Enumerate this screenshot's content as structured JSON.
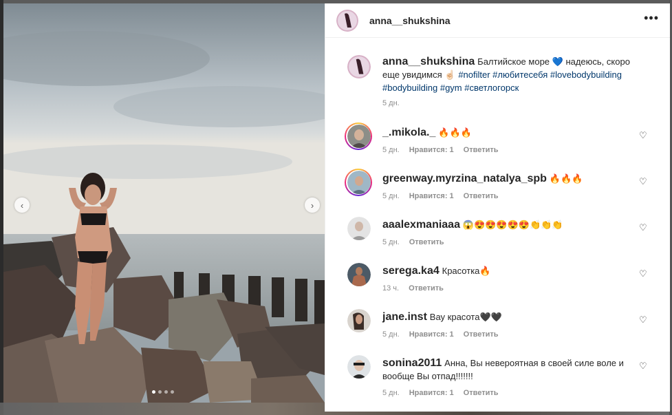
{
  "post": {
    "username": "anna__shukshina",
    "caption": {
      "text": "Балтийское море 💙 надеюсь, скоро еще увидимся ☝🏻",
      "hashtags": "#nofilter #любитесебя #lovebodybuilding #bodybuilding #gym #светлогорск",
      "time": "5 дн."
    },
    "carousel": {
      "prev_icon": "chevron-left-icon",
      "next_icon": "chevron-right-icon",
      "slide": 1,
      "total": 4
    }
  },
  "comments": [
    {
      "username": "_.mikola._",
      "text": "🔥🔥🔥",
      "time": "5 дн.",
      "likes": "Нравится: 1",
      "reply": "Ответить"
    },
    {
      "username": "greenway.myrzina_natalya_spb",
      "text": "🔥🔥🔥",
      "time": "5 дн.",
      "likes": "Нравится: 1",
      "reply": "Ответить"
    },
    {
      "username": "aaalexmaniaaa",
      "text": "😱😍😍😍😍😍👏👏👏",
      "time": "5 дн.",
      "likes": "",
      "reply": "Ответить"
    },
    {
      "username": "serega.ka4",
      "text": "Красотка🔥",
      "time": "13 ч.",
      "likes": "",
      "reply": "Ответить"
    },
    {
      "username": "jane.inst",
      "text": "Вау красота🖤🖤",
      "time": "5 дн.",
      "likes": "Нравится: 1",
      "reply": "Ответить"
    },
    {
      "username": "sonina2011",
      "text": "Анна, Вы невероятная в своей силе воле и вообще Вы отпад!!!!!!!",
      "time": "5 дн.",
      "likes": "Нравится: 1",
      "reply": "Ответить"
    }
  ],
  "icons": {
    "more": "more-horizontal-icon",
    "like": "heart-outline-icon"
  }
}
